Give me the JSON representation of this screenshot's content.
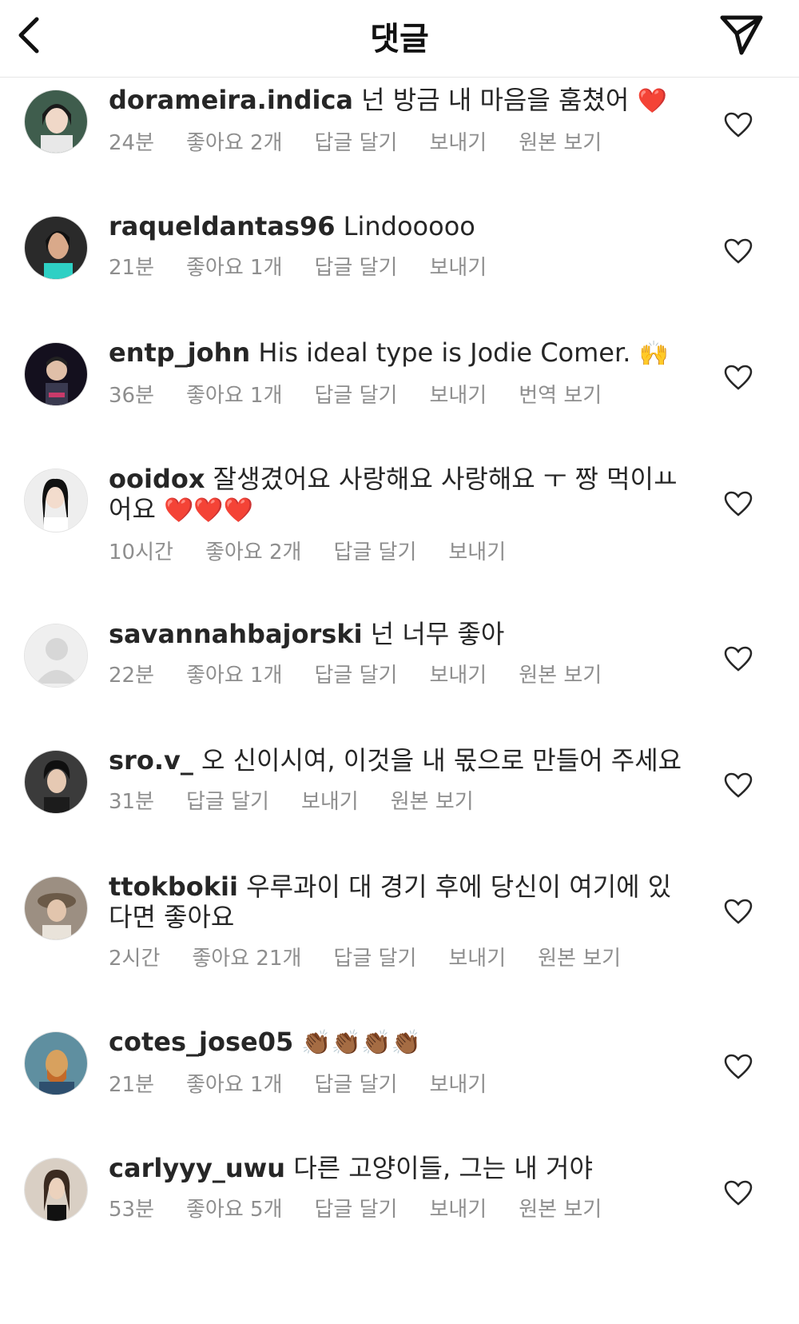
{
  "header": {
    "title": "댓글"
  },
  "comments": [
    {
      "username": "dorameira.indica",
      "text": "넌 방금 내 마음을 훔쳤어",
      "emoji": "❤️",
      "time": "24분",
      "likes": "좋아요 2개",
      "reply": "답글 달기",
      "send": "보내기",
      "extra": "원본 보기"
    },
    {
      "username": "raqueldantas96",
      "text": "Lindooooo",
      "emoji": "",
      "time": "21분",
      "likes": "좋아요 1개",
      "reply": "답글 달기",
      "send": "보내기",
      "extra": ""
    },
    {
      "username": "entp_john",
      "text": "His ideal type is Jodie Comer.",
      "emoji": "🙌",
      "time": "36분",
      "likes": "좋아요 1개",
      "reply": "답글 달기",
      "send": "보내기",
      "extra": "번역 보기"
    },
    {
      "username": "ooidox",
      "text": "잘생겼어요 사랑해요 사랑해요 ㅜ 짱 먹이ㅛ어요",
      "emoji": "❤️❤️❤️",
      "time": "10시간",
      "likes": "좋아요 2개",
      "reply": "답글 달기",
      "send": "보내기",
      "extra": ""
    },
    {
      "username": "savannahbajorski",
      "text": "넌 너무 좋아",
      "emoji": "",
      "time": "22분",
      "likes": "좋아요 1개",
      "reply": "답글 달기",
      "send": "보내기",
      "extra": "원본 보기"
    },
    {
      "username": "sro.v_",
      "text": "오 신이시여, 이것을 내 몫으로 만들어 주세요",
      "emoji": "",
      "time": "31분",
      "likes": "",
      "reply": "답글 달기",
      "send": "보내기",
      "extra": "원본 보기"
    },
    {
      "username": "ttokbokii",
      "text": "우루과이 대 경기 후에 당신이 여기에 있다면 좋아요",
      "emoji": "",
      "time": "2시간",
      "likes": "좋아요 21개",
      "reply": "답글 달기",
      "send": "보내기",
      "extra": "원본 보기"
    },
    {
      "username": "cotes_jose05",
      "text": "",
      "emoji": "👏🏾👏🏾👏🏾👏🏾",
      "time": "21분",
      "likes": "좋아요 1개",
      "reply": "답글 달기",
      "send": "보내기",
      "extra": ""
    },
    {
      "username": "carlyyy_uwu",
      "text": "다른 고양이들, 그는 내 거야",
      "emoji": "",
      "time": "53분",
      "likes": "좋아요 5개",
      "reply": "답글 달기",
      "send": "보내기",
      "extra": "원본 보기"
    }
  ]
}
